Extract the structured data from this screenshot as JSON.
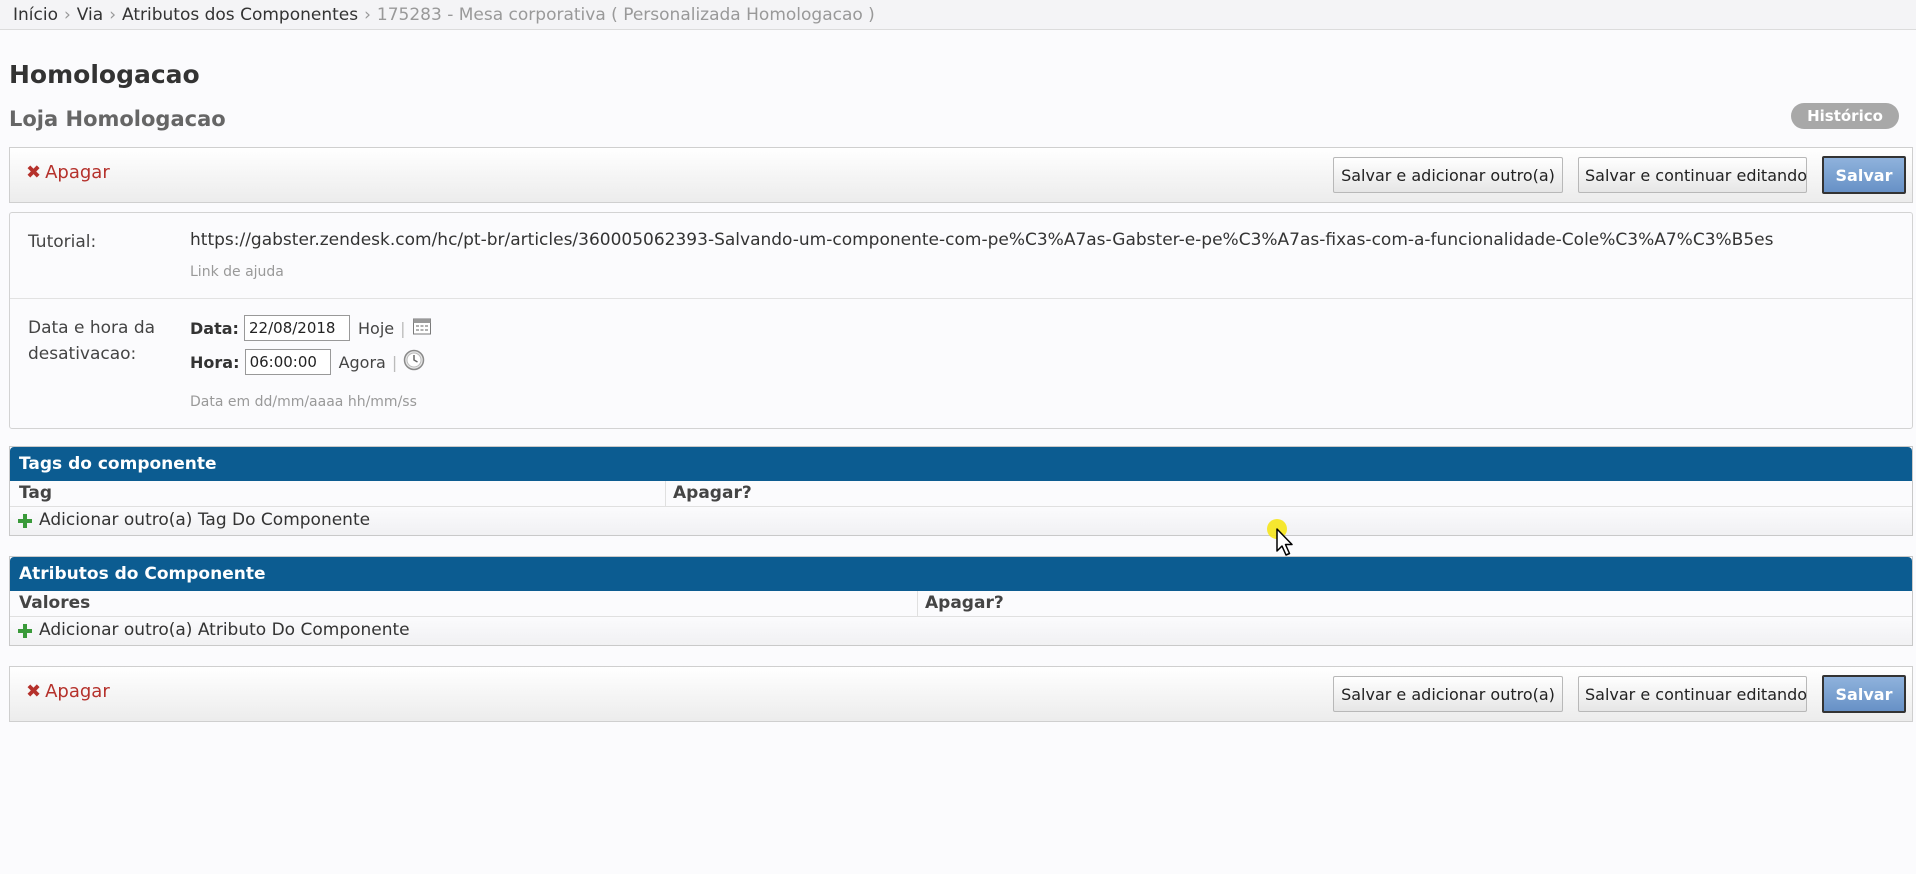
{
  "breadcrumb": {
    "items": [
      "Início",
      "Via",
      "Atributos dos Componentes"
    ],
    "current": "175283 - Mesa corporativa ( Personalizada Homologacao )",
    "separator": "›"
  },
  "page": {
    "title": "Homologacao",
    "subtitle": "Loja Homologacao",
    "history_button": "Histórico"
  },
  "submit_row": {
    "delete_label": "Apagar",
    "save_add_label": "Salvar e adicionar outro(a)",
    "save_continue_label": "Salvar e continuar editando",
    "save_label": "Salvar"
  },
  "form": {
    "tutorial": {
      "label": "Tutorial:",
      "value": "https://gabster.zendesk.com/hc/pt-br/articles/360005062393-Salvando-um-componente-com-pe%C3%A7as-Gabster-e-pe%C3%A7as-fixas-com-a-funcionalidade-Cole%C3%A7%C3%B5es",
      "help": "Link de ajuda"
    },
    "deactivation": {
      "label_line1": "Data e hora da",
      "label_line2": "desativacao:",
      "date_label": "Data:",
      "date_value": "22/08/2018",
      "today_link": "Hoje",
      "time_label": "Hora:",
      "time_value": "06:00:00",
      "now_link": "Agora",
      "help": "Data em dd/mm/aaaa hh/mm/ss"
    }
  },
  "tags_group": {
    "title": "Tags do componente",
    "columns": [
      "Tag",
      "Apagar?"
    ],
    "add_label": "Adicionar outro(a) Tag Do Componente"
  },
  "attributes_group": {
    "title": "Atributos do Componente",
    "columns": [
      "Valores",
      "Apagar?"
    ],
    "add_label": "Adicionar outro(a) Atributo Do Componente"
  },
  "colors": {
    "group_header": "#0c5c91",
    "delete": "#b5312b",
    "save_button": "#7aa0d1",
    "add_icon": "#3a9a3a"
  }
}
